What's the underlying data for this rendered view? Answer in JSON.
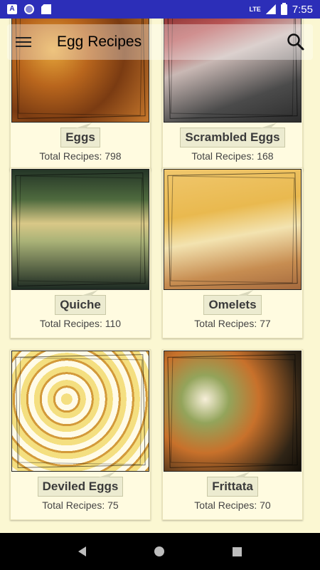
{
  "status_bar": {
    "network": "LTE",
    "time": "7:55"
  },
  "app_bar": {
    "title": "Egg Recipes"
  },
  "categories": [
    {
      "name": "Eggs",
      "count_text": "Total Recipes: 798"
    },
    {
      "name": "Scrambled Eggs",
      "count_text": "Total Recipes: 168"
    },
    {
      "name": "Quiche",
      "count_text": "Total Recipes: 110"
    },
    {
      "name": "Omelets",
      "count_text": "Total Recipes: 77"
    },
    {
      "name": "Deviled Eggs",
      "count_text": "Total Recipes: 75"
    },
    {
      "name": "Frittata",
      "count_text": "Total Recipes: 70"
    }
  ],
  "icons": {
    "menu": "hamburger-menu-icon",
    "search": "search-icon",
    "back": "back-icon",
    "home": "home-icon",
    "recent": "recent-apps-icon"
  },
  "colors": {
    "status_bar": "#2c2eb8",
    "background": "#fbf7d2"
  }
}
